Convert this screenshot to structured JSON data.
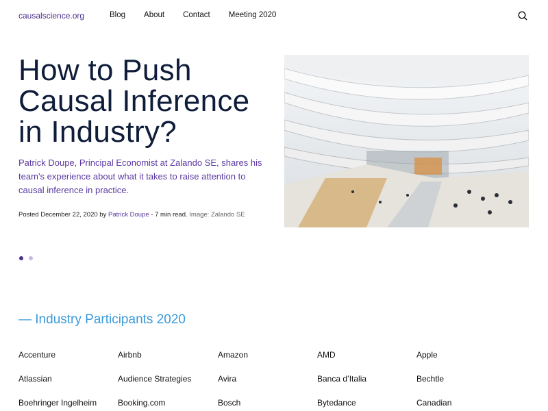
{
  "header": {
    "logo": "causalscience.org",
    "nav": [
      "Blog",
      "About",
      "Contact",
      "Meeting 2020"
    ],
    "search_icon": "search-icon"
  },
  "hero": {
    "title": "How to Push Causal Inference in Industry?",
    "lead": "Patrick Doupe, Principal Economist at Zalando SE, shares his team’s experience about what it takes to raise attention to causal inference in practice.",
    "meta_prefix": "Posted December 22, 2020 by",
    "author": "Patrick Doupe",
    "read_time": "- 7 min read.",
    "image_credit": "Image: Zalando SE",
    "slides_total": 2,
    "active_slide": 1
  },
  "participants": {
    "heading": "— Industry Participants 2020",
    "items": [
      "Accenture",
      "Airbnb",
      "Amazon",
      "AMD",
      "Apple",
      "Atlassian",
      "Audience Strategies",
      "Avira",
      "Banca d’Italia",
      "Bechtle",
      "Boehringer Ingelheim",
      "Booking.com",
      "Bosch",
      "Bytedance",
      "Canadian"
    ]
  },
  "colors": {
    "accent": "#4b2f8f",
    "heading_blue": "#3b9ad9",
    "title": "#0f1d3a"
  }
}
